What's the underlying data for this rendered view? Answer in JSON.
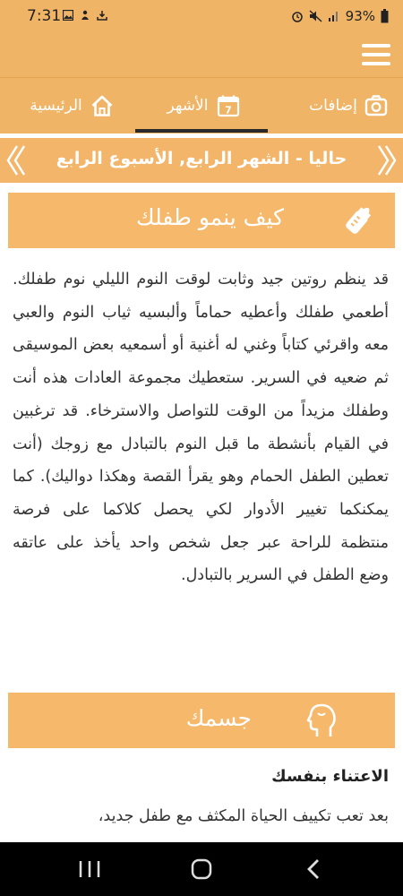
{
  "status": {
    "time": "7:31",
    "battery": "93%"
  },
  "tabs": [
    {
      "label": "إضافات",
      "icon": "camera-icon"
    },
    {
      "label": "الأشهر",
      "icon": "calendar-icon",
      "badge": "7"
    },
    {
      "label": "الرئيسية",
      "icon": "home-icon"
    }
  ],
  "week": {
    "title": "حاليا - الشهر الرابع, الأسبوع الرابع"
  },
  "section1": {
    "title": "كيف ينمو طفلك",
    "icon": "baby-bottle-icon",
    "body": "قد ينظم روتين جيد وثابت لوقت النوم الليلي نوم طفلك. أطعمي طفلك وأعطيه حماماً وألبسيه ثياب النوم والعبي معه واقرئي كتاباً وغني له أغنية أو أسمعيه بعض الموسيقى ثم ضعيه في السرير. ستعطيك مجموعة العادات هذه أنت وطفلك مزيداً من الوقت للتواصل والاسترخاء. قد ترغبين في القيام بأنشطة ما قبل النوم بالتبادل مع زوجك (أنت تعطين الطفل الحمام وهو يقرأ القصة وهكذا دواليك). كما يمكنكما تغيير الأدوار لكي يحصل كلاكما على فرصة منتظمة للراحة عبر جعل شخص واحد يأخذ على عاتقه وضع الطفل في السرير بالتبادل."
  },
  "section2": {
    "title": "جسمك",
    "icon": "head-profile-icon",
    "subheading": "الاعتناء بنفسك",
    "body": "بعد تعب تكييف الحياة المكثف مع طفل جديد،"
  },
  "colors": {
    "primary": "#f0b466",
    "section": "#f6b86b",
    "text": "#333333"
  }
}
